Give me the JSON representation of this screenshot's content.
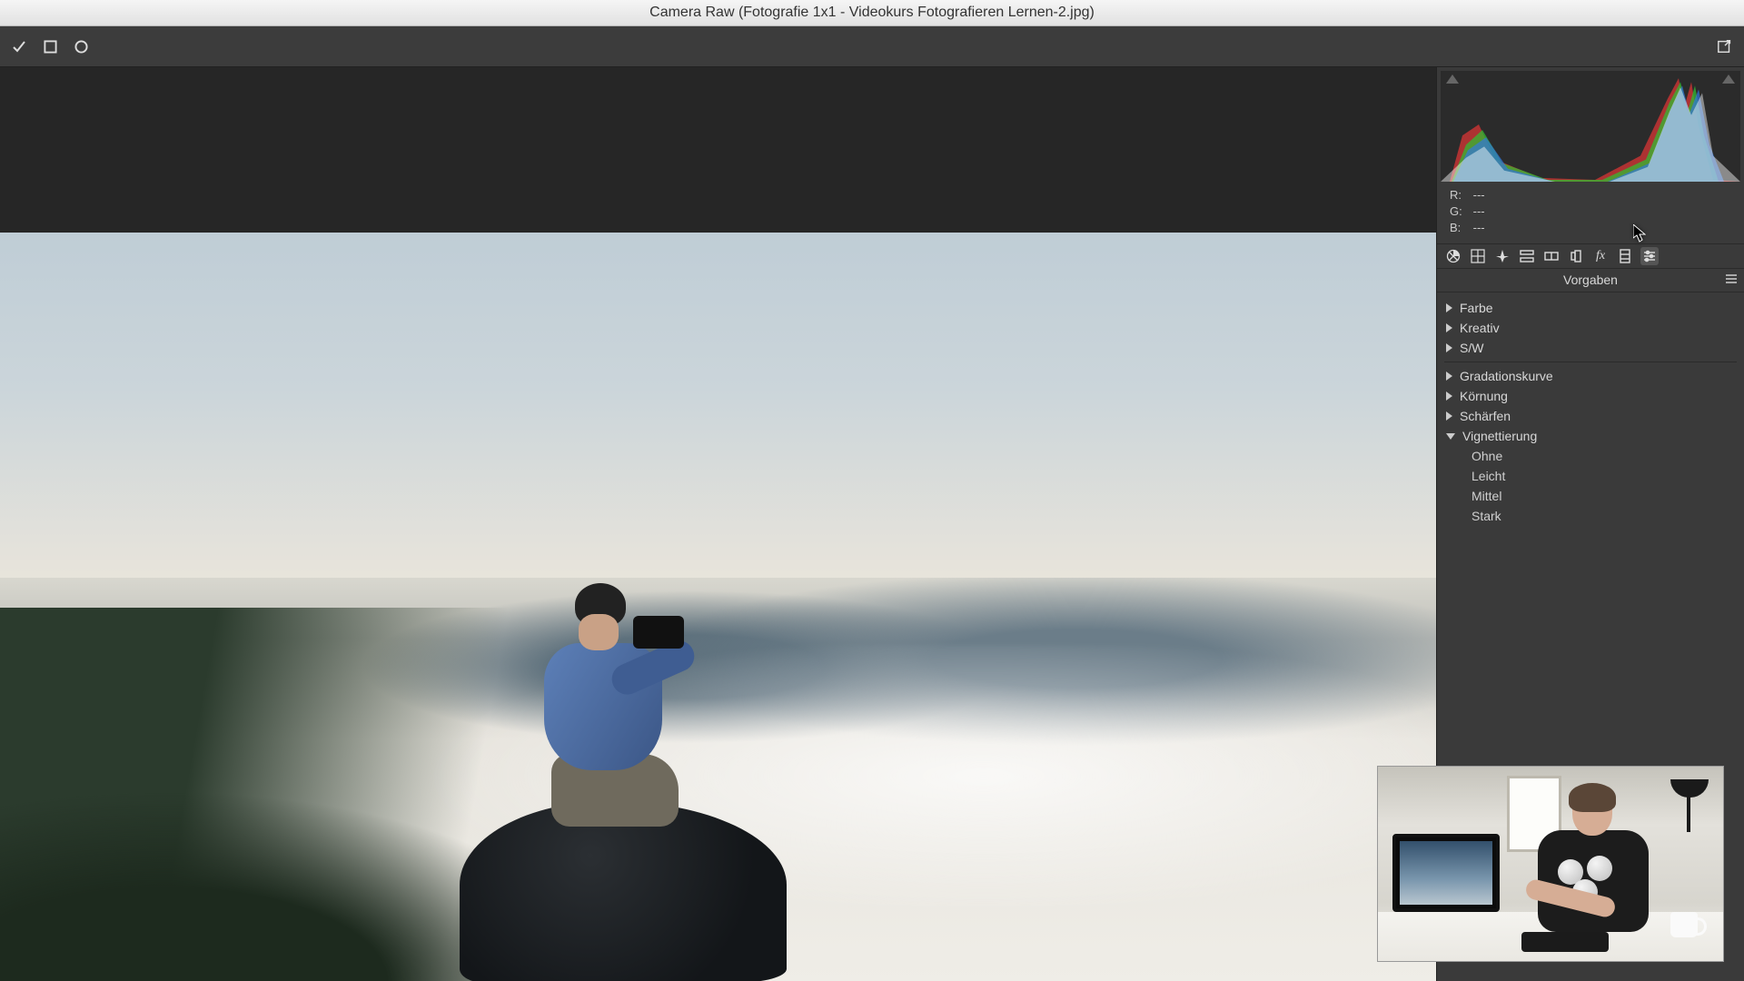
{
  "window": {
    "title": "Camera Raw (Fotografie 1x1 - Videokurs Fotografieren Lernen-2.jpg)"
  },
  "toolbar": {
    "icons": {
      "check": "check-icon",
      "square": "square-icon",
      "circle": "circle-icon",
      "export": "export-icon"
    }
  },
  "histogram": {
    "rgb": {
      "r_label": "R:",
      "g_label": "G:",
      "b_label": "B:",
      "r_value": "---",
      "g_value": "---",
      "b_value": "---"
    }
  },
  "tabs": {
    "basic": "aperture-icon",
    "tone_curve": "grid-icon",
    "detail": "sharpen-icon",
    "hsl": "hsl-icon",
    "split_toning": "split-icon",
    "lens": "lens-icon",
    "effects": "fx-icon",
    "calibration": "calibration-icon",
    "presets": "presets-icon"
  },
  "panel": {
    "title": "Vorgaben",
    "groups": {
      "color": "Farbe",
      "creative": "Kreativ",
      "bw": "S/W",
      "curve": "Gradationskurve",
      "grain": "Körnung",
      "sharpen": "Schärfen",
      "vignette": "Vignettierung"
    },
    "vignette_items": {
      "none": "Ohne",
      "light": "Leicht",
      "medium": "Mittel",
      "strong": "Stark"
    }
  }
}
